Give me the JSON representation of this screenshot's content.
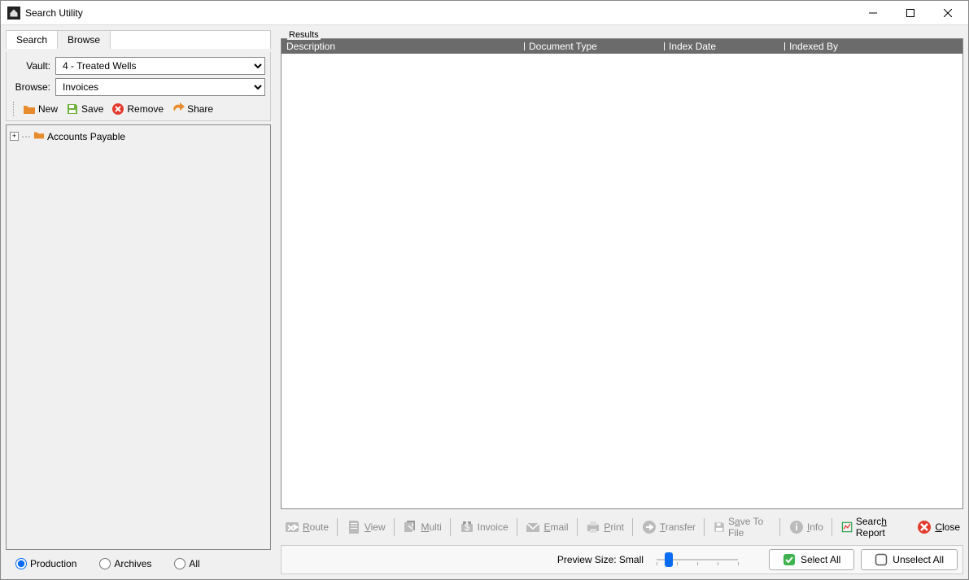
{
  "window": {
    "title": "Search Utility"
  },
  "tabs": {
    "search": "Search",
    "browse": "Browse"
  },
  "form": {
    "vault_label": "Vault:",
    "vault_value": "4 - Treated Wells",
    "browse_label": "Browse:",
    "browse_value": "Invoices"
  },
  "toolbar": {
    "new": "New",
    "save": "Save",
    "remove": "Remove",
    "share": "Share"
  },
  "tree": {
    "root": "Accounts Payable"
  },
  "radios": {
    "production": "Production",
    "archives": "Archives",
    "all": "All"
  },
  "results": {
    "label": "Results",
    "cols": {
      "description": "Description",
      "doctype": "Document Type",
      "indexdate": "Index Date",
      "indexedby": "Indexed By"
    }
  },
  "actions": {
    "route": "Route",
    "view": "View",
    "multi": "Multi",
    "invoice": "Invoice",
    "email": "Email",
    "print": "Print",
    "transfer": "Transfer",
    "savetofile": "Save To File",
    "info": "Info",
    "searchreport": "Search Report",
    "close": "Close"
  },
  "preview": {
    "label": "Preview Size: Small"
  },
  "selection": {
    "selectall": "Select All",
    "unselectall": "Unselect All"
  }
}
